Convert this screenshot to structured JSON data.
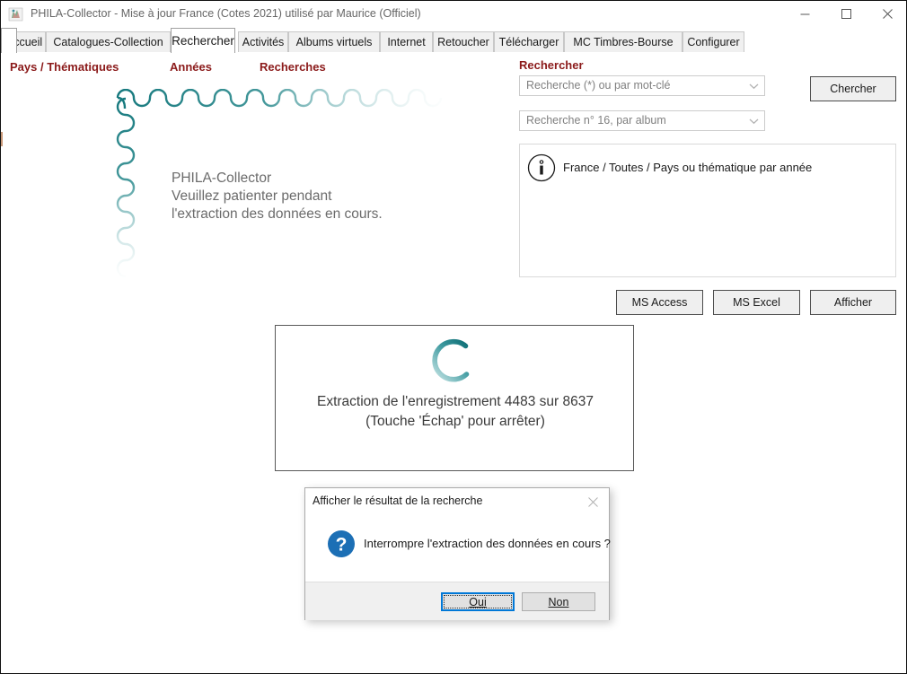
{
  "window": {
    "title": "PHILA-Collector - Mise à jour France (Cotes 2021) utilisé par Maurice (Officiel)",
    "app_icon": "stamp-icon",
    "controls": {
      "minimize": "minimize-icon",
      "maximize": "maximize-icon",
      "close": "close-icon"
    }
  },
  "tabs": [
    {
      "label": "Accueil",
      "active": false
    },
    {
      "label": "Catalogues-Collection",
      "active": false
    },
    {
      "label": "Rechercher",
      "active": true
    },
    {
      "label": "Activités",
      "active": false
    },
    {
      "label": "Albums virtuels",
      "active": false
    },
    {
      "label": "Internet",
      "active": false
    },
    {
      "label": "Retoucher",
      "active": false
    },
    {
      "label": "Télécharger",
      "active": false
    },
    {
      "label": "MC Timbres-Bourse",
      "active": false
    },
    {
      "label": "Configurer",
      "active": false
    }
  ],
  "sections": {
    "pays_thematiques": "Pays / Thématiques",
    "annees": "Années",
    "recherches": "Recherches",
    "rechercher": "Rechercher"
  },
  "splash": {
    "line1": "PHILA-Collector",
    "line2": "Veuillez patienter pendant",
    "line3": "l'extraction des données en cours.",
    "graphic": "stamp-perforation-border",
    "accent_color": "#1a7f82"
  },
  "search": {
    "keyword_combo_value": "Recherche (*) ou par mot-clé",
    "album_combo_value": "Recherche n° 16, par album",
    "chercher_label": "Chercher",
    "dropdown_icon": "chevron-down-icon"
  },
  "results": {
    "info_icon": "info-icon",
    "info_text": "France / Toutes / Pays ou thématique par année"
  },
  "actions": {
    "ms_access": "MS Access",
    "ms_excel": "MS Excel",
    "afficher": "Afficher"
  },
  "progress": {
    "spinner": "loading-spinner-icon",
    "line1": "Extraction de l'enregistrement 4483 sur 8637",
    "line2": "(Touche 'Échap' pour arrêter)",
    "current_record": 4483,
    "total_records": 8637
  },
  "dialog": {
    "title": "Afficher le résultat de la recherche",
    "close_icon": "close-icon",
    "question_icon": "question-mark-icon",
    "message": "Interrompre l'extraction des données en cours ?",
    "buttons": {
      "yes": "Oui",
      "no": "Non"
    },
    "accent_color": "#0078d7"
  }
}
